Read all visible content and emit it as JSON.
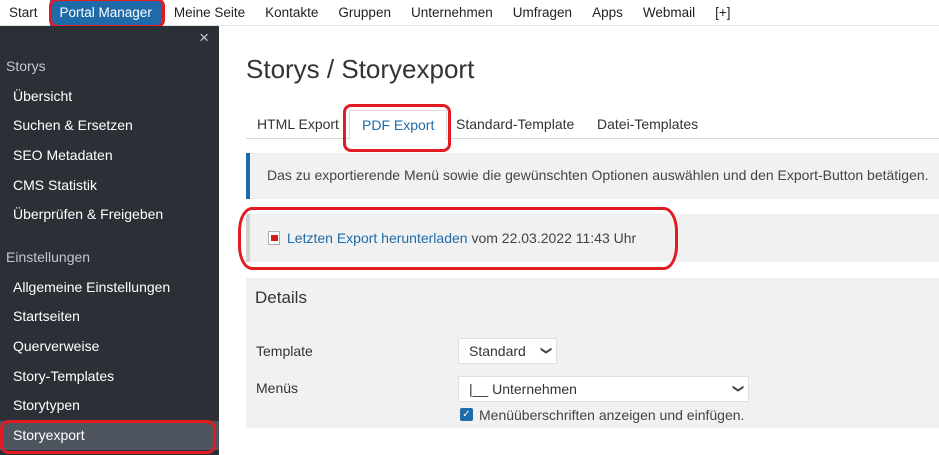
{
  "topnav": {
    "items": [
      "Start",
      "Portal Manager",
      "Meine Seite",
      "Kontakte",
      "Gruppen",
      "Unternehmen",
      "Umfragen",
      "Apps",
      "Webmail",
      "[+]"
    ]
  },
  "sidebar": {
    "close": "×",
    "section_storys": "Storys",
    "storys_items": [
      "Übersicht",
      "Suchen & Ersetzen",
      "SEO Metadaten",
      "CMS Statistik",
      "Überprüfen & Freigeben"
    ],
    "section_settings": "Einstellungen",
    "settings_items": [
      "Allgemeine Einstellungen",
      "Startseiten",
      "Querverweise",
      "Story-Templates",
      "Storytypen",
      "Storyexport"
    ]
  },
  "page": {
    "title": "Storys / Storyexport"
  },
  "tabs": [
    "HTML Export",
    "PDF Export",
    "Standard-Template",
    "Datei-Templates"
  ],
  "info": {
    "text": "Das zu exportierende Menü sowie die gewünschten Optionen auswählen und den Export-Button betätigen."
  },
  "export": {
    "link": "Letzten Export herunterladen",
    "suffix": " vom 22.03.2022 11:43 Uhr"
  },
  "details": {
    "title": "Details",
    "template_label": "Template",
    "template_value": "Standard",
    "menus_label": "Menüs",
    "menus_value": "|__ Unternehmen",
    "checkbox_label": "Menüüberschriften anzeigen und einfügen."
  },
  "colors": {
    "accent": "#1f6aa8",
    "sidebar_bg": "#2b2f36",
    "annotation": "#e11b22"
  }
}
